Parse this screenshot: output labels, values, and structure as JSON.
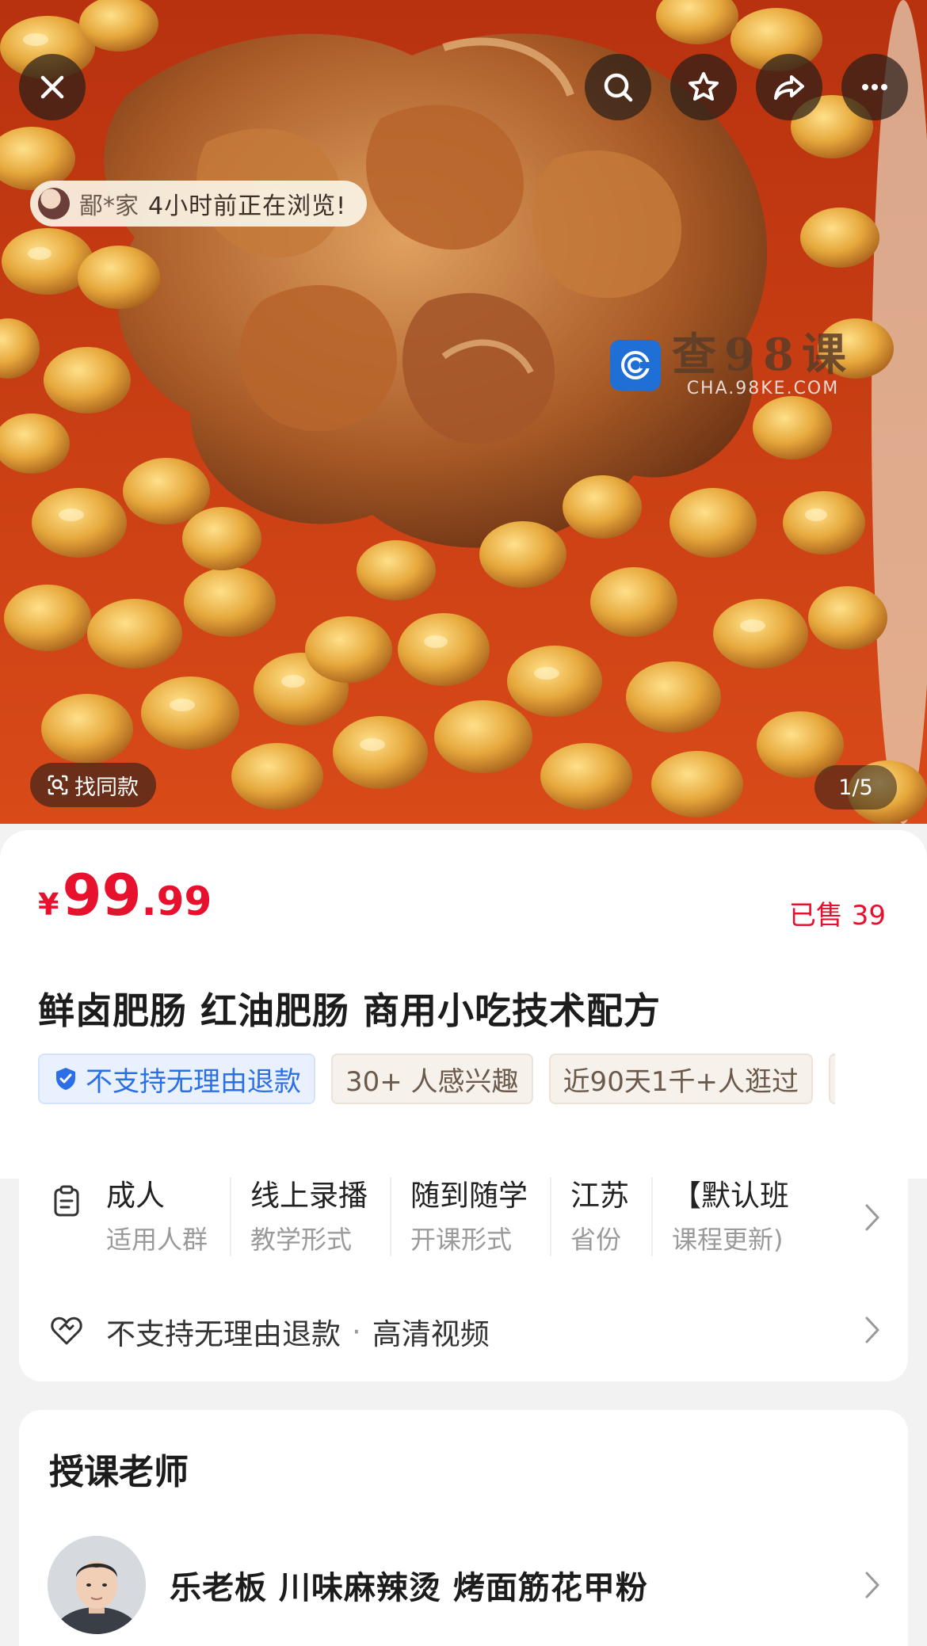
{
  "hero": {
    "viewer_name": "鄙*家",
    "viewer_status": "4小时前正在浏览!",
    "watermark_cn": "查98课",
    "watermark_en": "CHA.98KE.COM",
    "find_similar_label": "找同款",
    "page_indicator": "1/5",
    "icons": [
      "close-icon",
      "search-icon",
      "star-icon",
      "share-icon",
      "more-icon"
    ]
  },
  "product": {
    "currency": "¥",
    "price_int": "99",
    "price_dec": ".99",
    "sold_text": "已售 39",
    "title": "鲜卤肥肠  红油肥肠 商用小吃技术配方",
    "tags": {
      "refund": "不支持无理由退款",
      "interest": "30+ 人感兴趣",
      "visits": "近90天1千+人逛过"
    }
  },
  "attributes": {
    "items": [
      {
        "value": "成人",
        "key": "适用人群"
      },
      {
        "value": "线上录播",
        "key": "教学形式"
      },
      {
        "value": "随到随学",
        "key": "开课形式"
      },
      {
        "value": "江苏",
        "key": "省份"
      },
      {
        "value": "【默认班",
        "key": "课程更新)"
      }
    ],
    "service_refund": "不支持无理由退款",
    "service_separator": "·",
    "service_quality": "高清视频"
  },
  "teacher": {
    "section_title": "授课老师",
    "name": "乐老板 川味麻辣烫 烤面筋花甲粉"
  },
  "colors": {
    "price_red": "#e8112d",
    "tag_blue": "#2b6fe6",
    "food_orange": "#e0a640",
    "broth_red": "#c23a12"
  }
}
